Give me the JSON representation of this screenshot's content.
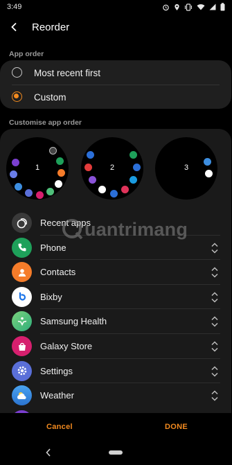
{
  "status_bar": {
    "time": "3:49"
  },
  "header": {
    "title": "Reorder"
  },
  "app_order": {
    "section_label": "App order",
    "options": [
      {
        "label": "Most recent first",
        "selected": false
      },
      {
        "label": "Custom",
        "selected": true
      }
    ]
  },
  "customise": {
    "section_label": "Customise app order",
    "watch_pages": [
      {
        "number": "1"
      },
      {
        "number": "2"
      },
      {
        "number": "3"
      }
    ]
  },
  "apps": [
    {
      "label": "Recent apps",
      "icon": "recent-apps-icon",
      "color": "#3a3a3a",
      "reorderable": false
    },
    {
      "label": "Phone",
      "icon": "phone-icon",
      "color": "#1ea05a",
      "reorderable": true
    },
    {
      "label": "Contacts",
      "icon": "contacts-icon",
      "color": "#f57c2a",
      "reorderable": true
    },
    {
      "label": "Bixby",
      "icon": "bixby-icon",
      "color": "#ffffff",
      "reorderable": true
    },
    {
      "label": "Samsung Health",
      "icon": "samsung-health-icon",
      "color": "#4fbf7a",
      "reorderable": true
    },
    {
      "label": "Galaxy Store",
      "icon": "galaxy-store-icon",
      "color": "#d61f6e",
      "reorderable": true
    },
    {
      "label": "Settings",
      "icon": "settings-icon",
      "color": "#5a6fd8",
      "reorderable": true
    },
    {
      "label": "Weather",
      "icon": "weather-icon",
      "color": "#3d8ee0",
      "reorderable": true
    }
  ],
  "actions": {
    "cancel": "Cancel",
    "done": "DONE"
  },
  "watermark": {
    "text": "uantrimang"
  },
  "colors": {
    "accent": "#f28a1f",
    "background": "#000000",
    "card": "#1f1f1f"
  }
}
